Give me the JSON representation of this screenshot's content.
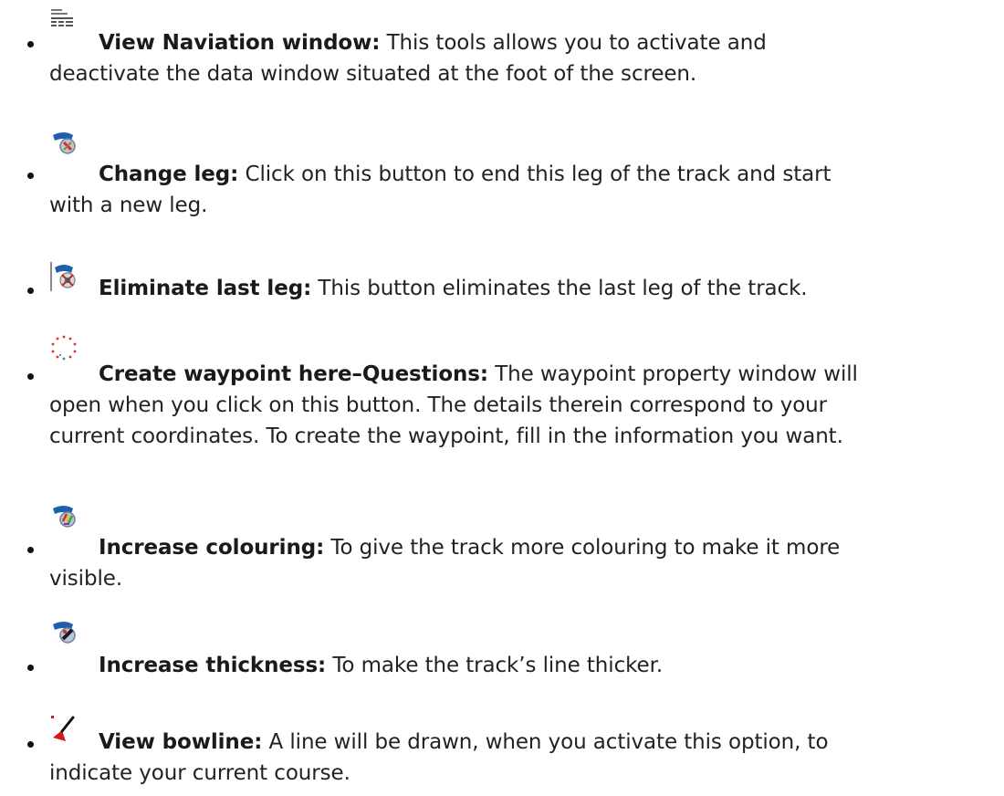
{
  "items": [
    {
      "icon": "view-navigation-window-icon",
      "term": "View Naviation window:",
      "lines": [
        "This tools allows you to activate and",
        "deactivate the data window situated at the foot of the screen."
      ]
    },
    {
      "icon": "change-leg-icon",
      "term": "Change leg:",
      "lines": [
        "Click on this button to end this leg of the track and start",
        "with a new leg."
      ]
    },
    {
      "icon": "eliminate-last-leg-icon",
      "term": "Eliminate last leg:",
      "lines": [
        "This button eliminates the last leg of the track."
      ]
    },
    {
      "icon": "create-waypoint-icon",
      "term": "Create waypoint here–Questions:",
      "lines": [
        "The waypoint property window will",
        "open when you click on this button. The details therein correspond to your",
        "current coordinates. To create the waypoint, fill in the information you want."
      ]
    },
    {
      "icon": "increase-colouring-icon",
      "term": "Increase colouring:",
      "lines": [
        "To give the track more colouring to make it more",
        "visible."
      ]
    },
    {
      "icon": "increase-thickness-icon",
      "term": "Increase thickness:",
      "lines": [
        "To make the track’s line thicker."
      ]
    },
    {
      "icon": "view-bowline-icon",
      "term": "View bowline:",
      "lines": [
        "A line will be drawn, when you activate this option, to",
        "indicate your current course."
      ]
    }
  ]
}
